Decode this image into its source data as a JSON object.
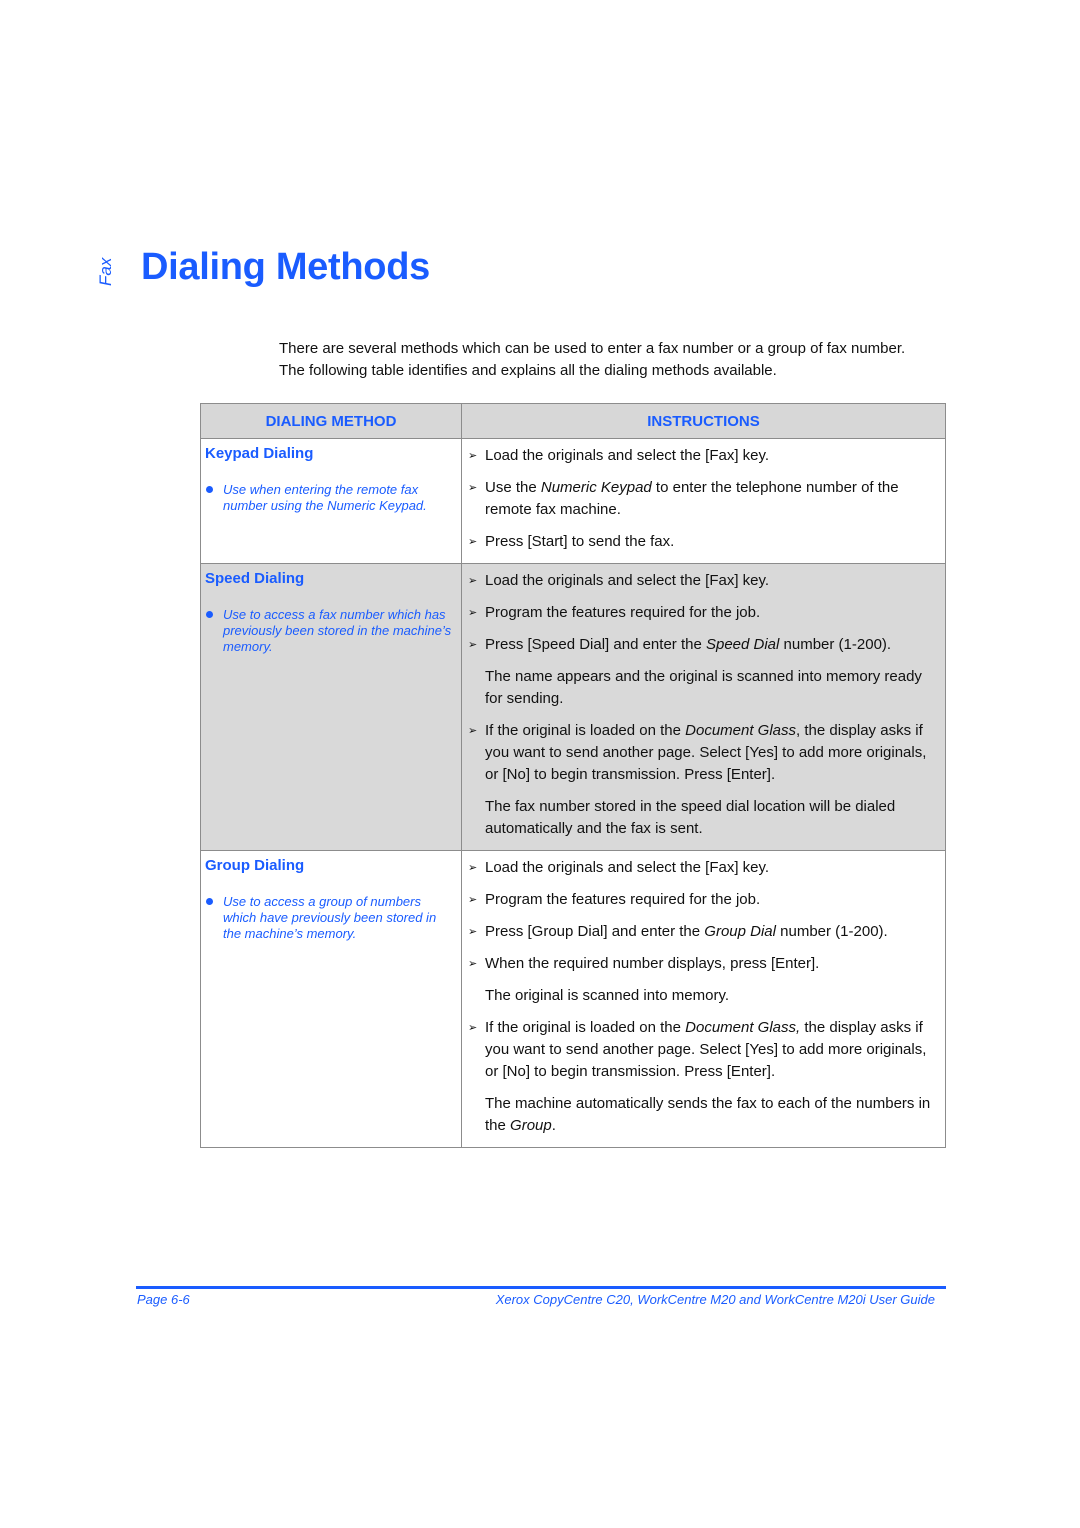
{
  "side_label": "Fax",
  "title": "Dialing Methods",
  "intro": [
    "There are several methods which can be used to enter a fax number or a group of fax number.",
    "The following table identifies and explains all the dialing methods available."
  ],
  "table": {
    "headers": {
      "method": "DIALING METHOD",
      "instructions": "INSTRUCTIONS"
    },
    "rows": [
      {
        "name": "Keypad Dialing",
        "note": "Use when entering the remote fax number using the Numeric Keypad.",
        "steps": [
          {
            "bullet": true,
            "parts": [
              "Load the originals and select the [Fax] key."
            ]
          },
          {
            "bullet": true,
            "parts": [
              "Use the ",
              "Numeric Keypad",
              " to enter the telephone number of the remote fax machine."
            ]
          },
          {
            "bullet": true,
            "parts": [
              "Press [Start] to send the fax."
            ]
          }
        ]
      },
      {
        "name": "Speed Dialing",
        "note": "Use to access a fax number which has previously been stored in the machine’s memory.",
        "steps": [
          {
            "bullet": true,
            "parts": [
              "Load the originals and select the [Fax] key."
            ]
          },
          {
            "bullet": true,
            "parts": [
              "Program the features required for the job."
            ]
          },
          {
            "bullet": true,
            "parts": [
              "Press [Speed Dial] and enter the ",
              "Speed Dial",
              " number (1-200)."
            ]
          },
          {
            "bullet": false,
            "parts": [
              "The name appears and the original is scanned into memory ready for sending."
            ]
          },
          {
            "bullet": true,
            "parts": [
              "If the original is loaded on the ",
              "Document Glass",
              ", the display asks if you want to send another page. Select [Yes] to add more originals, or [No] to begin transmission. Press [Enter]."
            ]
          },
          {
            "bullet": false,
            "parts": [
              "The fax number stored in the speed dial location will be dialed automatically and the fax is sent."
            ]
          }
        ]
      },
      {
        "name": "Group Dialing",
        "note": "Use to access a group of numbers which have previously been stored in the machine’s memory.",
        "steps": [
          {
            "bullet": true,
            "parts": [
              "Load the originals and select the [Fax] key."
            ]
          },
          {
            "bullet": true,
            "parts": [
              "Program the features required for the job."
            ]
          },
          {
            "bullet": true,
            "parts": [
              "Press [Group Dial] and enter the ",
              "Group Dial",
              " number (1-200)."
            ]
          },
          {
            "bullet": true,
            "parts": [
              "When the required number displays, press [Enter]."
            ]
          },
          {
            "bullet": false,
            "parts": [
              "The original is scanned into memory."
            ]
          },
          {
            "bullet": true,
            "parts": [
              "If the original is loaded on the ",
              "Document Glass,",
              " the display asks if you want to send another page. Select [Yes] to add more originals, or [No] to begin transmission. Press [Enter]."
            ]
          },
          {
            "bullet": false,
            "parts": [
              "The machine automatically sends the fax to each of the numbers in the ",
              "Group",
              "."
            ]
          }
        ]
      }
    ]
  },
  "footer": {
    "page": "Page 6-6",
    "guide": "Xerox CopyCentre C20, WorkCentre M20 and WorkCentre M20i User Guide"
  },
  "colors": {
    "accent": "#1a5cff",
    "shaded_row": "#d9d9d9",
    "header_bg": "#d7d7d7"
  }
}
